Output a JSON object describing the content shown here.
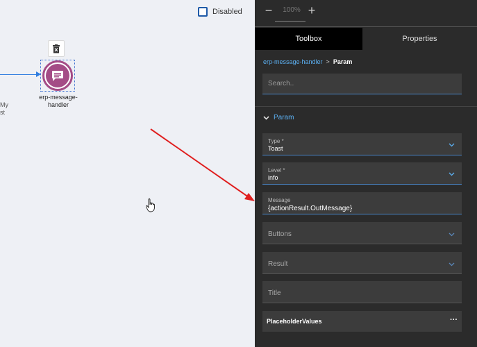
{
  "canvas": {
    "disabled_label": "Disabled",
    "node_label_line1": "erp-message-",
    "node_label_line2": "handler",
    "stub_line1": "My",
    "stub_line2": "st"
  },
  "zoom": {
    "minus": "−",
    "value": "100%",
    "plus": "+"
  },
  "tabs": [
    {
      "label": "Toolbox",
      "active": true
    },
    {
      "label": "Properties",
      "active": false
    }
  ],
  "breadcrumb": {
    "parent": "erp-message-handler",
    "separator": ">",
    "current": "Param"
  },
  "search": {
    "placeholder": "Search.."
  },
  "section": {
    "title": "Param"
  },
  "fields": {
    "type": {
      "label": "Type *",
      "value": "Toast"
    },
    "level": {
      "label": "Level *",
      "value": "info"
    },
    "message": {
      "label": "Message",
      "value": "{actionResult.OutMessage}"
    },
    "buttons": {
      "placeholder": "Buttons"
    },
    "result": {
      "placeholder": "Result"
    },
    "title": {
      "placeholder": "Title"
    }
  },
  "placeholder_values": {
    "label": "PlaceholderValues",
    "more": "···"
  },
  "colors": {
    "accent": "#5cb0f2",
    "node": "#a44c86",
    "annotation_arrow": "#e02020"
  }
}
